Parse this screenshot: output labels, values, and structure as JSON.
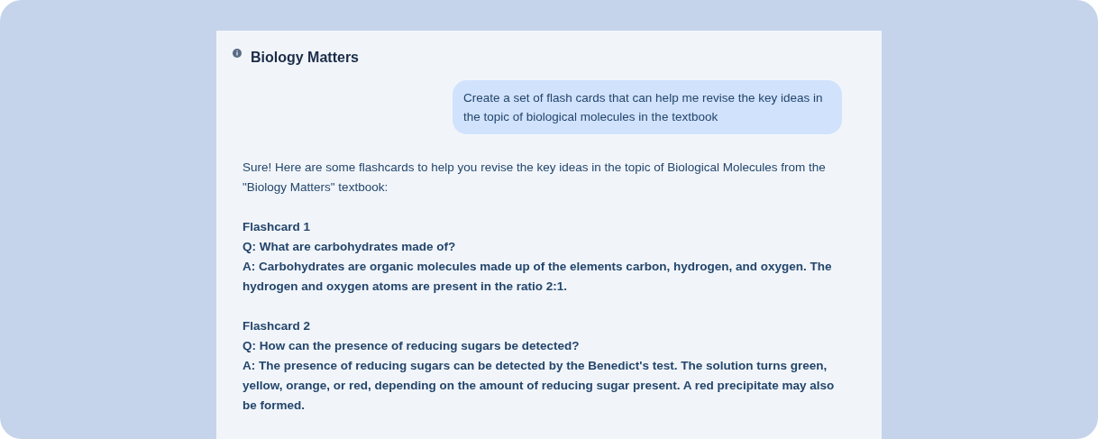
{
  "header": {
    "title": "Biology Matters"
  },
  "user_message": "Create a set of flash cards that can help me revise the key ideas in the topic of biological molecules in the textbook",
  "reply": {
    "intro": "Sure! Here are some flashcards to help you revise the key ideas in the topic of Biological Molecules from the \"Biology Matters\" textbook:",
    "flashcards": [
      {
        "title": "Flashcard 1",
        "question": "Q: What are carbohydrates made of?",
        "answer": "A: Carbohydrates are organic molecules made up of the elements carbon, hydrogen, and oxygen. The hydrogen and oxygen atoms are present in the ratio 2:1."
      },
      {
        "title": "Flashcard 2",
        "question": "Q: How can the presence of reducing sugars be detected?",
        "answer": "A: The presence of reducing sugars can be detected by the Benedict's test. The solution turns green, yellow, orange, or red, depending on the amount of reducing sugar present. A red precipitate may also be formed."
      }
    ]
  }
}
